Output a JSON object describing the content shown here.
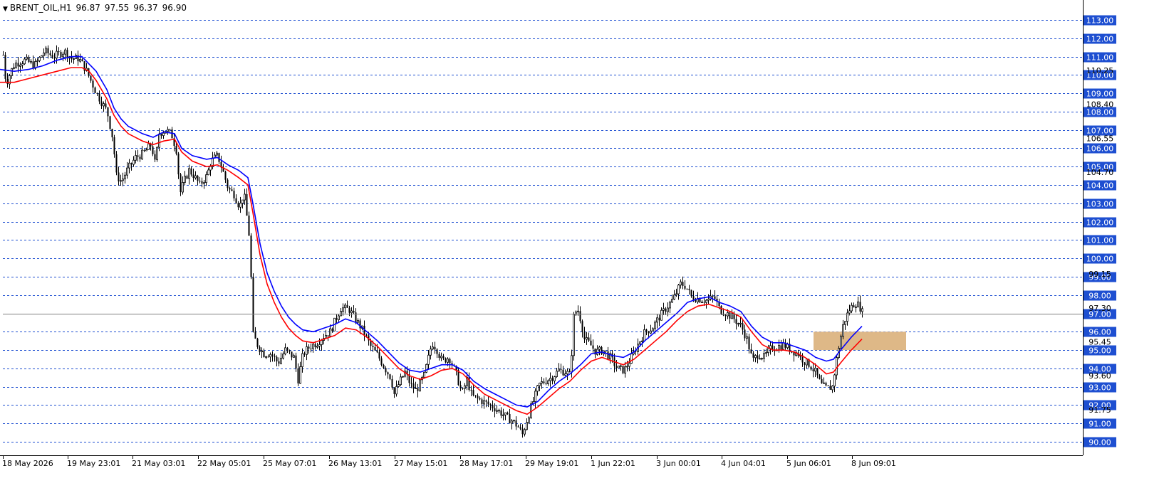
{
  "header": {
    "symbol_tf": "BRENT_OIL,H1",
    "open": "96.87",
    "high": "97.55",
    "low": "96.37",
    "close": "96.90"
  },
  "colors": {
    "background": "#ffffff",
    "grid": "#1e4fd1",
    "price_label_bg": "#1e4fd1",
    "price_label_text": "#ffffff",
    "candle": "#000000",
    "ma_fast": "#0000ff",
    "ma_slow": "#ff0000",
    "zone": "#deb887"
  },
  "chart_data": {
    "type": "candlestick",
    "symbol": "BRENT_OIL",
    "timeframe": "H1",
    "ylim": [
      89.6,
      113.6
    ],
    "grid": true,
    "y_levels": [
      "113.00",
      "112.00",
      "111.00",
      "110.00",
      "109.00",
      "108.00",
      "107.00",
      "106.00",
      "105.00",
      "104.00",
      "103.00",
      "102.00",
      "101.00",
      "100.00",
      "99.00",
      "98.00",
      "97.00",
      "96.00",
      "95.00",
      "94.00",
      "93.00",
      "92.00",
      "91.00",
      "90.00"
    ],
    "minor_ticks": [
      "110.25",
      "108.40",
      "106.55",
      "104.70",
      "99.15",
      "97.30",
      "95.45",
      "93.60",
      "91.75"
    ],
    "x_ticks": [
      "18 May 2026",
      "19 May 23:01",
      "21 May 03:01",
      "22 May 05:01",
      "25 May 07:01",
      "26 May 13:01",
      "27 May 15:01",
      "28 May 17:01",
      "29 May 19:01",
      "1 Jun 22:01",
      "3 Jun 00:01",
      "4 Jun 04:01",
      "5 Jun 06:01",
      "8 Jun 09:01"
    ],
    "price_path": [
      [
        0,
        110.0
      ],
      [
        3,
        111.5
      ],
      [
        8,
        109.5
      ],
      [
        15,
        110.2
      ],
      [
        20,
        110.6
      ],
      [
        35,
        110.8
      ],
      [
        48,
        110.5
      ],
      [
        62,
        111.3
      ],
      [
        75,
        111.0
      ],
      [
        90,
        111.3
      ],
      [
        100,
        110.9
      ],
      [
        110,
        110.9
      ],
      [
        120,
        110.3
      ],
      [
        135,
        109.0
      ],
      [
        150,
        108.0
      ],
      [
        158,
        106.5
      ],
      [
        163,
        104.5
      ],
      [
        170,
        104.2
      ],
      [
        178,
        104.8
      ],
      [
        190,
        105.5
      ],
      [
        200,
        105.7
      ],
      [
        212,
        106.2
      ],
      [
        218,
        105.0
      ],
      [
        222,
        106.8
      ],
      [
        232,
        107.0
      ],
      [
        240,
        106.8
      ],
      [
        248,
        105.8
      ],
      [
        252,
        103.5
      ],
      [
        258,
        104.2
      ],
      [
        265,
        104.8
      ],
      [
        272,
        104.5
      ],
      [
        280,
        104.0
      ],
      [
        290,
        104.5
      ],
      [
        296,
        105.3
      ],
      [
        305,
        105.6
      ],
      [
        312,
        104.8
      ],
      [
        320,
        103.8
      ],
      [
        328,
        103.5
      ],
      [
        336,
        102.8
      ],
      [
        342,
        103.6
      ],
      [
        350,
        101.0
      ],
      [
        355,
        95.8
      ],
      [
        362,
        95.2
      ],
      [
        370,
        94.8
      ],
      [
        380,
        94.8
      ],
      [
        390,
        94.3
      ],
      [
        400,
        95.0
      ],
      [
        412,
        94.6
      ],
      [
        418,
        93.4
      ],
      [
        425,
        94.8
      ],
      [
        435,
        95.2
      ],
      [
        445,
        95.4
      ],
      [
        455,
        95.8
      ],
      [
        463,
        96.0
      ],
      [
        470,
        96.6
      ],
      [
        478,
        97.3
      ],
      [
        490,
        97.2
      ],
      [
        500,
        96.6
      ],
      [
        510,
        96.0
      ],
      [
        520,
        95.2
      ],
      [
        530,
        94.7
      ],
      [
        540,
        94.0
      ],
      [
        548,
        93.5
      ],
      [
        553,
        92.6
      ],
      [
        560,
        93.2
      ],
      [
        568,
        93.8
      ],
      [
        576,
        93.1
      ],
      [
        584,
        92.8
      ],
      [
        595,
        93.6
      ],
      [
        600,
        94.4
      ],
      [
        606,
        95.4
      ],
      [
        612,
        95.1
      ],
      [
        620,
        94.4
      ],
      [
        630,
        94.6
      ],
      [
        640,
        93.7
      ],
      [
        648,
        92.6
      ],
      [
        655,
        93.4
      ],
      [
        662,
        92.5
      ],
      [
        672,
        92.3
      ],
      [
        682,
        92.1
      ],
      [
        692,
        91.9
      ],
      [
        702,
        91.6
      ],
      [
        712,
        91.3
      ],
      [
        720,
        91.1
      ],
      [
        727,
        90.8
      ],
      [
        733,
        90.4
      ],
      [
        740,
        91.3
      ],
      [
        748,
        92.2
      ],
      [
        756,
        93.1
      ],
      [
        764,
        93.3
      ],
      [
        774,
        93.5
      ],
      [
        784,
        93.9
      ],
      [
        794,
        93.8
      ],
      [
        800,
        93.6
      ],
      [
        805,
        96.8
      ],
      [
        810,
        97.3
      ],
      [
        815,
        96.6
      ],
      [
        820,
        95.6
      ],
      [
        828,
        95.3
      ],
      [
        836,
        94.9
      ],
      [
        846,
        95.0
      ],
      [
        856,
        94.6
      ],
      [
        866,
        94.0
      ],
      [
        876,
        93.9
      ],
      [
        886,
        94.6
      ],
      [
        895,
        95.3
      ],
      [
        905,
        96.0
      ],
      [
        915,
        96.2
      ],
      [
        925,
        96.8
      ],
      [
        935,
        97.3
      ],
      [
        945,
        97.8
      ],
      [
        955,
        98.6
      ],
      [
        962,
        98.5
      ],
      [
        970,
        97.9
      ],
      [
        980,
        97.8
      ],
      [
        992,
        97.7
      ],
      [
        1002,
        97.9
      ],
      [
        1010,
        97.2
      ],
      [
        1020,
        97.0
      ],
      [
        1030,
        96.7
      ],
      [
        1040,
        96.3
      ],
      [
        1048,
        95.6
      ],
      [
        1056,
        94.4
      ],
      [
        1064,
        94.8
      ],
      [
        1072,
        94.6
      ],
      [
        1082,
        95.1
      ],
      [
        1092,
        95.2
      ],
      [
        1100,
        95.3
      ],
      [
        1110,
        95.0
      ],
      [
        1120,
        94.8
      ],
      [
        1128,
        94.4
      ],
      [
        1136,
        94.2
      ],
      [
        1144,
        93.8
      ],
      [
        1152,
        93.1
      ],
      [
        1160,
        92.9
      ],
      [
        1168,
        93.0
      ],
      [
        1176,
        95.0
      ],
      [
        1184,
        96.5
      ],
      [
        1192,
        97.2
      ],
      [
        1200,
        97.6
      ],
      [
        1206,
        97.4
      ],
      [
        1212,
        96.9
      ]
    ],
    "ma_fast_path": [
      [
        0,
        110.3
      ],
      [
        20,
        110.2
      ],
      [
        40,
        110.3
      ],
      [
        60,
        110.5
      ],
      [
        80,
        110.8
      ],
      [
        100,
        111.0
      ],
      [
        115,
        111.0
      ],
      [
        125,
        110.6
      ],
      [
        135,
        110.2
      ],
      [
        150,
        109.2
      ],
      [
        160,
        108.2
      ],
      [
        170,
        107.6
      ],
      [
        180,
        107.2
      ],
      [
        200,
        106.8
      ],
      [
        215,
        106.6
      ],
      [
        230,
        106.9
      ],
      [
        245,
        106.8
      ],
      [
        255,
        106.0
      ],
      [
        270,
        105.6
      ],
      [
        290,
        105.4
      ],
      [
        305,
        105.5
      ],
      [
        320,
        105.1
      ],
      [
        335,
        104.8
      ],
      [
        348,
        104.4
      ],
      [
        355,
        103.0
      ],
      [
        365,
        100.8
      ],
      [
        375,
        99.2
      ],
      [
        385,
        98.2
      ],
      [
        395,
        97.4
      ],
      [
        405,
        96.8
      ],
      [
        415,
        96.4
      ],
      [
        425,
        96.1
      ],
      [
        440,
        96.0
      ],
      [
        455,
        96.2
      ],
      [
        470,
        96.4
      ],
      [
        485,
        96.7
      ],
      [
        500,
        96.5
      ],
      [
        515,
        96.0
      ],
      [
        530,
        95.5
      ],
      [
        545,
        94.9
      ],
      [
        560,
        94.3
      ],
      [
        575,
        93.9
      ],
      [
        590,
        93.8
      ],
      [
        605,
        94.0
      ],
      [
        620,
        94.2
      ],
      [
        635,
        94.2
      ],
      [
        650,
        93.9
      ],
      [
        665,
        93.3
      ],
      [
        680,
        92.9
      ],
      [
        695,
        92.6
      ],
      [
        710,
        92.3
      ],
      [
        725,
        92.0
      ],
      [
        740,
        91.9
      ],
      [
        755,
        92.2
      ],
      [
        770,
        92.8
      ],
      [
        785,
        93.3
      ],
      [
        800,
        93.7
      ],
      [
        815,
        94.2
      ],
      [
        830,
        94.8
      ],
      [
        845,
        94.9
      ],
      [
        860,
        94.7
      ],
      [
        875,
        94.6
      ],
      [
        890,
        94.9
      ],
      [
        905,
        95.5
      ],
      [
        920,
        96.0
      ],
      [
        935,
        96.5
      ],
      [
        950,
        97.0
      ],
      [
        965,
        97.6
      ],
      [
        980,
        97.8
      ],
      [
        995,
        97.9
      ],
      [
        1010,
        97.6
      ],
      [
        1025,
        97.4
      ],
      [
        1040,
        97.1
      ],
      [
        1055,
        96.3
      ],
      [
        1070,
        95.7
      ],
      [
        1085,
        95.4
      ],
      [
        1100,
        95.4
      ],
      [
        1115,
        95.2
      ],
      [
        1130,
        95.0
      ],
      [
        1145,
        94.6
      ],
      [
        1160,
        94.4
      ],
      [
        1170,
        94.5
      ],
      [
        1180,
        95.0
      ],
      [
        1195,
        95.7
      ],
      [
        1210,
        96.3
      ]
    ],
    "ma_slow_path": [
      [
        0,
        109.6
      ],
      [
        20,
        109.6
      ],
      [
        40,
        109.8
      ],
      [
        60,
        110.0
      ],
      [
        80,
        110.2
      ],
      [
        100,
        110.4
      ],
      [
        115,
        110.4
      ],
      [
        125,
        110.2
      ],
      [
        135,
        109.7
      ],
      [
        150,
        108.7
      ],
      [
        160,
        107.8
      ],
      [
        170,
        107.2
      ],
      [
        180,
        106.8
      ],
      [
        200,
        106.4
      ],
      [
        215,
        106.2
      ],
      [
        230,
        106.4
      ],
      [
        245,
        106.5
      ],
      [
        255,
        105.8
      ],
      [
        270,
        105.3
      ],
      [
        290,
        105.0
      ],
      [
        305,
        105.1
      ],
      [
        320,
        104.8
      ],
      [
        335,
        104.4
      ],
      [
        348,
        104.0
      ],
      [
        355,
        102.5
      ],
      [
        365,
        100.2
      ],
      [
        375,
        98.6
      ],
      [
        385,
        97.6
      ],
      [
        395,
        96.8
      ],
      [
        405,
        96.2
      ],
      [
        415,
        95.8
      ],
      [
        425,
        95.5
      ],
      [
        440,
        95.4
      ],
      [
        455,
        95.6
      ],
      [
        470,
        95.8
      ],
      [
        485,
        96.2
      ],
      [
        500,
        96.1
      ],
      [
        515,
        95.7
      ],
      [
        530,
        95.2
      ],
      [
        545,
        94.6
      ],
      [
        560,
        94.0
      ],
      [
        575,
        93.6
      ],
      [
        590,
        93.4
      ],
      [
        605,
        93.6
      ],
      [
        620,
        93.9
      ],
      [
        635,
        94.0
      ],
      [
        650,
        93.7
      ],
      [
        665,
        93.1
      ],
      [
        680,
        92.6
      ],
      [
        695,
        92.3
      ],
      [
        710,
        92.0
      ],
      [
        725,
        91.7
      ],
      [
        740,
        91.5
      ],
      [
        755,
        91.9
      ],
      [
        770,
        92.4
      ],
      [
        785,
        92.9
      ],
      [
        800,
        93.3
      ],
      [
        815,
        93.9
      ],
      [
        830,
        94.4
      ],
      [
        845,
        94.6
      ],
      [
        860,
        94.4
      ],
      [
        875,
        94.2
      ],
      [
        890,
        94.5
      ],
      [
        905,
        95.0
      ],
      [
        920,
        95.5
      ],
      [
        935,
        96.0
      ],
      [
        950,
        96.6
      ],
      [
        965,
        97.1
      ],
      [
        980,
        97.4
      ],
      [
        995,
        97.5
      ],
      [
        1010,
        97.3
      ],
      [
        1025,
        97.1
      ],
      [
        1040,
        96.8
      ],
      [
        1055,
        96.0
      ],
      [
        1070,
        95.3
      ],
      [
        1085,
        95.0
      ],
      [
        1100,
        95.0
      ],
      [
        1115,
        94.9
      ],
      [
        1130,
        94.6
      ],
      [
        1145,
        94.2
      ],
      [
        1160,
        93.7
      ],
      [
        1170,
        93.8
      ],
      [
        1180,
        94.3
      ],
      [
        1195,
        95.0
      ],
      [
        1210,
        95.6
      ]
    ],
    "zone": {
      "from_price": 95.0,
      "to_price": 96.0,
      "from_x": 1142,
      "to_x": 1272
    },
    "current_price": "97.00"
  }
}
